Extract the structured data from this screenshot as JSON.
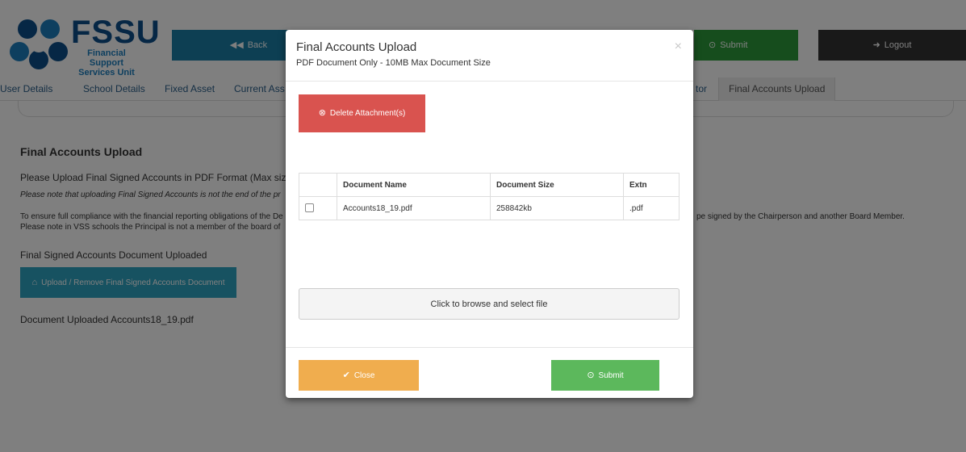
{
  "logo": {
    "big": "FSSU",
    "sub1": "Financial Support",
    "sub2": "Services Unit"
  },
  "header": {
    "back": "Back",
    "submit": "Submit",
    "logout": "Logout"
  },
  "tabs": [
    {
      "label": "User Details"
    },
    {
      "label": "School Details"
    },
    {
      "label": "Fixed Asset"
    },
    {
      "label": "Current Ass"
    },
    {
      "label": "tor"
    },
    {
      "label": "Final Accounts Upload",
      "active": true
    }
  ],
  "page": {
    "title": "Final Accounts Upload",
    "instruction": "Please Upload Final Signed Accounts in PDF Format (Max size",
    "note": "Please note that uploading Final Signed Accounts is not the end of the pr",
    "compliance1": "To ensure full compliance with the financial reporting obligations of the De",
    "compliance1_right": "pe signed by the Chairperson and another Board Member.",
    "compliance2": "Please note in VSS schools the Principal is not a member of the board of",
    "uploaded_label": "Final Signed Accounts Document Uploaded",
    "upload_button": "Upload / Remove Final Signed Accounts Document",
    "uploaded_doc": "Document Uploaded Accounts18_19.pdf"
  },
  "modal": {
    "title": "Final Accounts Upload",
    "subtitle": "PDF Document Only - 10MB Max Document Size",
    "close_x": "×",
    "delete_button": "Delete Attachment(s)",
    "table": {
      "headers": [
        "",
        "Document Name",
        "Document Size",
        "Extn"
      ],
      "rows": [
        {
          "checked": false,
          "name": "Accounts18_19.pdf",
          "size": "258842kb",
          "ext": ".pdf"
        }
      ]
    },
    "browse": "Click to browse and select file",
    "close_button": "Close",
    "submit_button": "Submit"
  },
  "colors": {
    "brand": "#0d4f8b",
    "back": "#1a7fa6",
    "submit_top": "#2c9a3a",
    "logout": "#333333",
    "delete": "#d9534f",
    "close": "#f0ad4e",
    "submit": "#5cb85c"
  }
}
